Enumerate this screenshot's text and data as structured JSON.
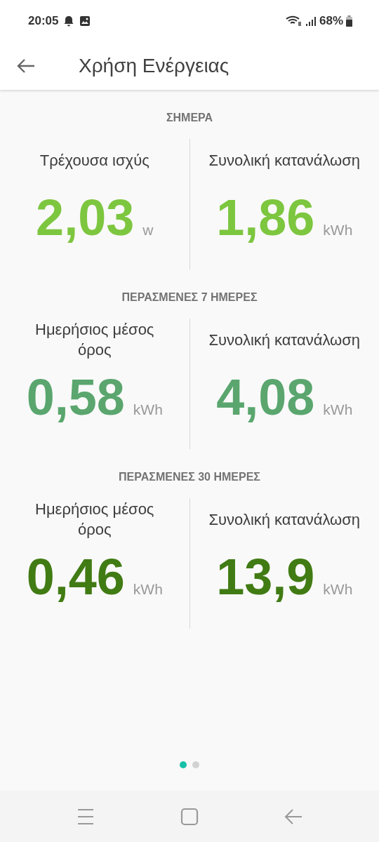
{
  "status_bar": {
    "time": "20:05",
    "battery": "68%"
  },
  "app_bar": {
    "title": "Χρήση Ενέργειας"
  },
  "sections": [
    {
      "heading": "ΣΗΜΕΡΑ",
      "color": "#7dc63f",
      "stats": [
        {
          "label": "Τρέχουσα ισχύς",
          "value": "2,03",
          "unit": "w"
        },
        {
          "label": "Συνολική κατανάλωση",
          "value": "1,86",
          "unit": "kWh"
        }
      ]
    },
    {
      "heading": "ΠΕΡΑΣΜΕΝΕΣ 7 ΗΜΕΡΕΣ",
      "color": "#5aa66e",
      "stats": [
        {
          "label": "Ημερήσιος μέσος όρος",
          "value": "0,58",
          "unit": "kWh"
        },
        {
          "label": "Συνολική κατανάλωση",
          "value": "4,08",
          "unit": "kWh"
        }
      ]
    },
    {
      "heading": "ΠΕΡΑΣΜΕΝΕΣ 30 ΗΜΕΡΕΣ",
      "color": "#417b14",
      "stats": [
        {
          "label": "Ημερήσιος μέσος όρος",
          "value": "0,46",
          "unit": "kWh"
        },
        {
          "label": "Συνολική κατανάλωση",
          "value": "13,9",
          "unit": "kWh"
        }
      ]
    }
  ],
  "pages": [
    {
      "selected": true
    },
    {
      "selected": false
    }
  ]
}
